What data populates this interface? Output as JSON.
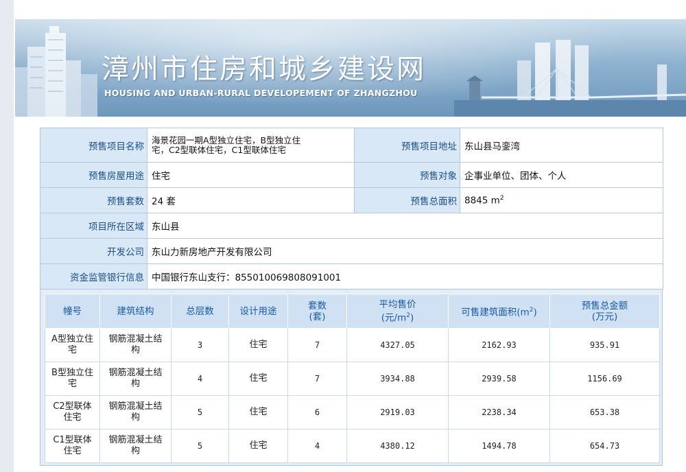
{
  "site": {
    "title": "漳州市住房和城乡建设网",
    "subtitle": "HOUSING AND URBAN-RURAL DEVELOPEMENT OF ZHANGZHOU"
  },
  "info": {
    "project_name_label": "预售项目名称",
    "project_name_line1": "海景花园一期A型独立住宅，B型独立住",
    "project_name_line2": "宅，C2型联体住宅，C1型联体住宅",
    "address_label": "预售项目地址",
    "address": "东山县马銮湾",
    "usage_label": "预售房屋用途",
    "usage": "住宅",
    "target_label": "预售对象",
    "target": "企事业单位、团体、个人",
    "units_label": "预售套数",
    "units": "24 套",
    "area_label": "预售总面积",
    "area_value": "8845 m",
    "area_exp": "2",
    "district_label": "项目所在区域",
    "district": "东山县",
    "developer_label": "开发公司",
    "developer": "东山力新房地产开发有限公司",
    "bank_label": "资金监管银行信息",
    "bank": "中国银行东山支行：855010069808091001"
  },
  "buildings": {
    "headers": {
      "id": "幢号",
      "structure": "建筑结构",
      "floors": "总层数",
      "use": "设计用途",
      "units_l1": "套数",
      "units_l2": "(套)",
      "price_l1": "平均售价",
      "price_l2a": "(元/m",
      "price_l2b": "2",
      "price_l2c": ")",
      "area_a": "可售建筑面积(m",
      "area_b": "2",
      "area_c": ")",
      "total_l1": "预售总金额",
      "total_l2": "(万元)"
    },
    "rows": [
      {
        "id_l1": "A型独立住",
        "id_l2": "宅",
        "structure_l1": "钢筋混凝土结",
        "structure_l2": "构",
        "floors": "3",
        "use": "住宅",
        "units": "7",
        "price": "4327.05",
        "area": "2162.93",
        "total": "935.91"
      },
      {
        "id_l1": "B型独立住",
        "id_l2": "宅",
        "structure_l1": "钢筋混凝土结",
        "structure_l2": "构",
        "floors": "4",
        "use": "住宅",
        "units": "7",
        "price": "3934.88",
        "area": "2939.58",
        "total": "1156.69"
      },
      {
        "id_l1": "C2型联体",
        "id_l2": "住宅",
        "structure_l1": "钢筋混凝土结",
        "structure_l2": "构",
        "floors": "5",
        "use": "住宅",
        "units": "6",
        "price": "2919.03",
        "area": "2238.34",
        "total": "653.38"
      },
      {
        "id_l1": "C1型联体",
        "id_l2": "住宅",
        "structure_l1": "钢筋混凝土结",
        "structure_l2": "构",
        "floors": "5",
        "use": "住宅",
        "units": "4",
        "price": "4380.12",
        "area": "1494.78",
        "total": "654.73"
      }
    ]
  }
}
